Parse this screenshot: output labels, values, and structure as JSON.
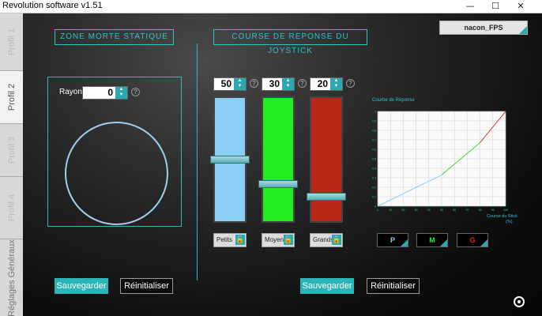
{
  "window": {
    "title": "Revolution software v1.51",
    "minimize": "—",
    "maximize": "☐",
    "close": "✕"
  },
  "sidebar": {
    "tabs": [
      {
        "label": "Profil 1"
      },
      {
        "label": "Profil 2"
      },
      {
        "label": "Profil 3"
      },
      {
        "label": "Profil 4"
      },
      {
        "label": "Réglages Généraux"
      }
    ]
  },
  "profile_name": "nacon_FPS",
  "dead_zone": {
    "header": "ZONE MORTE STATIQUE",
    "radius_label": "Rayon:",
    "radius_value": "0",
    "save": "Sauvegarder",
    "reset": "Réinitialiser"
  },
  "response": {
    "header": "COURSE DE REPONSE DU JOYSTICK",
    "sliders": [
      {
        "value": "50",
        "lock_label": "Petits",
        "lock_icon": "unlocked",
        "fill": 0.5,
        "color": "#89cff3"
      },
      {
        "value": "30",
        "lock_label": "Moyens",
        "lock_icon": "unlocked",
        "fill": 0.3,
        "color": "#20ee20"
      },
      {
        "value": "20",
        "lock_label": "Grands",
        "lock_icon": "locked",
        "fill": 0.2,
        "color": "#b82814"
      }
    ],
    "buttons": [
      "P",
      "M",
      "G"
    ],
    "button_colors": [
      "#89cff3",
      "#20ee20",
      "#e02a1a"
    ],
    "save": "Sauvegarder",
    "reset": "Réinitialiser"
  },
  "chart_data": {
    "type": "line",
    "title": "Courbe de Réponse",
    "xlabel": "Course du Stick (%)",
    "ylabel": "",
    "xlim": [
      0,
      100
    ],
    "ylim": [
      0,
      1
    ],
    "xticks": [
      "0",
      "10",
      "20",
      "30",
      "40",
      "50",
      "60",
      "70",
      "80",
      "90",
      "100"
    ],
    "yticks": [
      "0",
      "0.1",
      "0.2",
      "0.3",
      "0.4",
      "0.5",
      "0.6",
      "0.7",
      "0.8",
      "0.9",
      "1"
    ],
    "grid": true,
    "series": [
      {
        "color": "#89cff3",
        "x": [
          0,
          50
        ],
        "y": [
          0,
          0.33
        ]
      },
      {
        "color": "#3ad83a",
        "x": [
          50,
          80
        ],
        "y": [
          0.33,
          0.67
        ]
      },
      {
        "color": "#d8302a",
        "x": [
          80,
          100
        ],
        "y": [
          0.67,
          1.0
        ]
      }
    ]
  }
}
